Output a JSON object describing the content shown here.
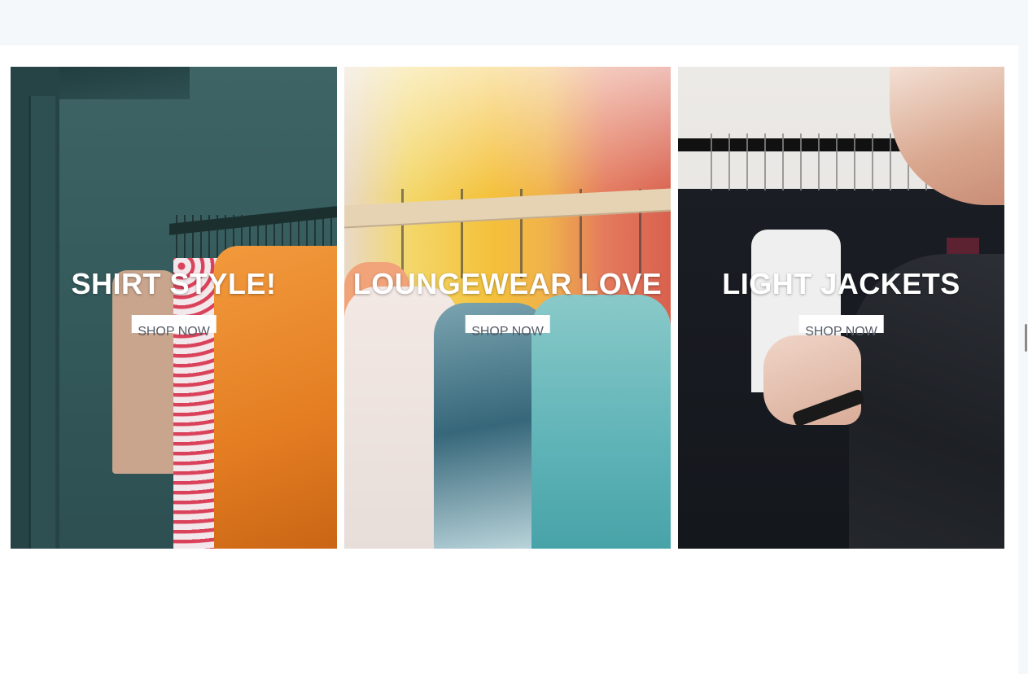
{
  "banners": [
    {
      "title": "SHIRT STYLE!",
      "cta_label": "SHOP NOW"
    },
    {
      "title": "LOUNGEWEAR LOVE",
      "cta_label": "SHOP NOW"
    },
    {
      "title": "LIGHT JACKETS",
      "cta_label": "SHOP NOW"
    }
  ],
  "colors": {
    "page_background": "#f5f8fb",
    "content_background": "#ffffff",
    "headline_text": "#ffffff",
    "button_background": "#ffffff",
    "button_text": "#555b66"
  }
}
